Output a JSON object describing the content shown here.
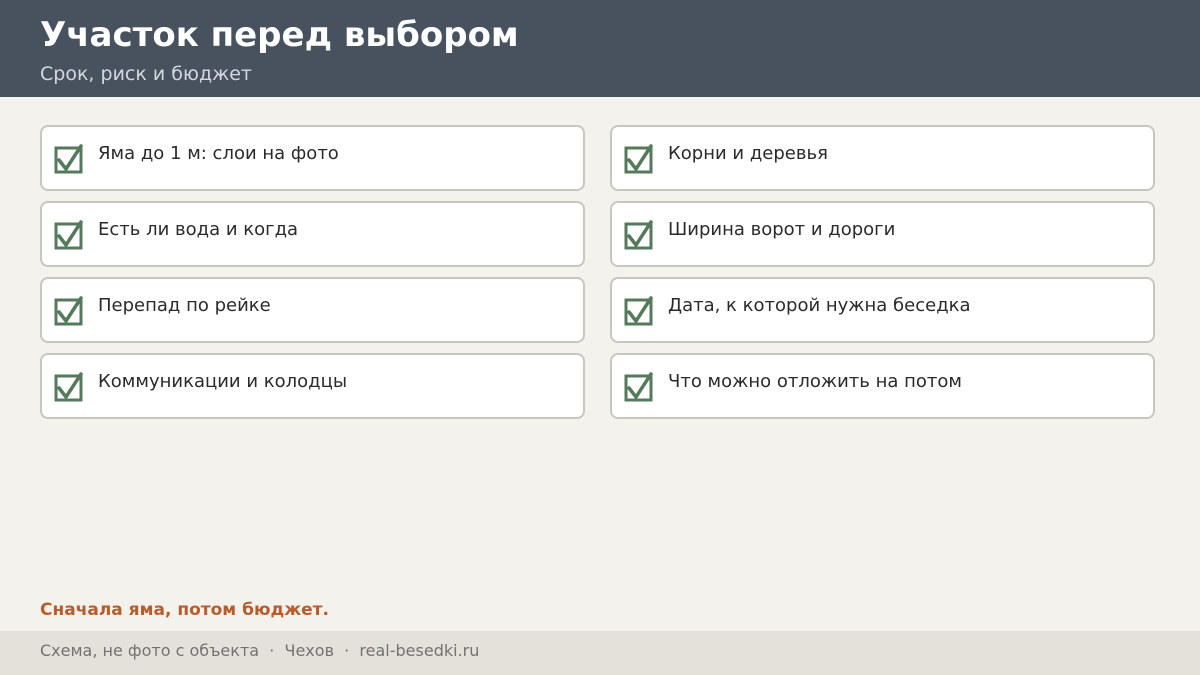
{
  "header": {
    "title": "Участок перед выбором",
    "subtitle": "Срок, риск и бюджет"
  },
  "checklist": {
    "left": [
      {
        "label": "Яма до 1 м: слои на фото",
        "icon": "checkbox-checked-icon"
      },
      {
        "label": "Есть ли вода и когда",
        "icon": "checkbox-checked-icon"
      },
      {
        "label": "Перепад по рейке",
        "icon": "checkbox-checked-icon"
      },
      {
        "label": "Коммуникации и колодцы",
        "icon": "checkbox-checked-icon"
      }
    ],
    "right": [
      {
        "label": "Корни и деревья",
        "icon": "checkbox-checked-icon"
      },
      {
        "label": "Ширина ворот и дороги",
        "icon": "checkbox-checked-icon"
      },
      {
        "label": "Дата, к которой нужна беседка",
        "icon": "checkbox-checked-icon"
      },
      {
        "label": "Что можно отложить на потом",
        "icon": "checkbox-checked-icon"
      }
    ]
  },
  "callout": "Сначала яма, потом бюджет.",
  "footer": {
    "text": "Схема, не фото с объекта  ·  Чехов  ·  real-besedki.ru"
  },
  "colors": {
    "header_bg": "#48525e",
    "page_bg": "#f4f2ed",
    "check_green": "#557a5b",
    "accent_orange": "#b85c2b",
    "footer_bg": "#e4e1da"
  }
}
